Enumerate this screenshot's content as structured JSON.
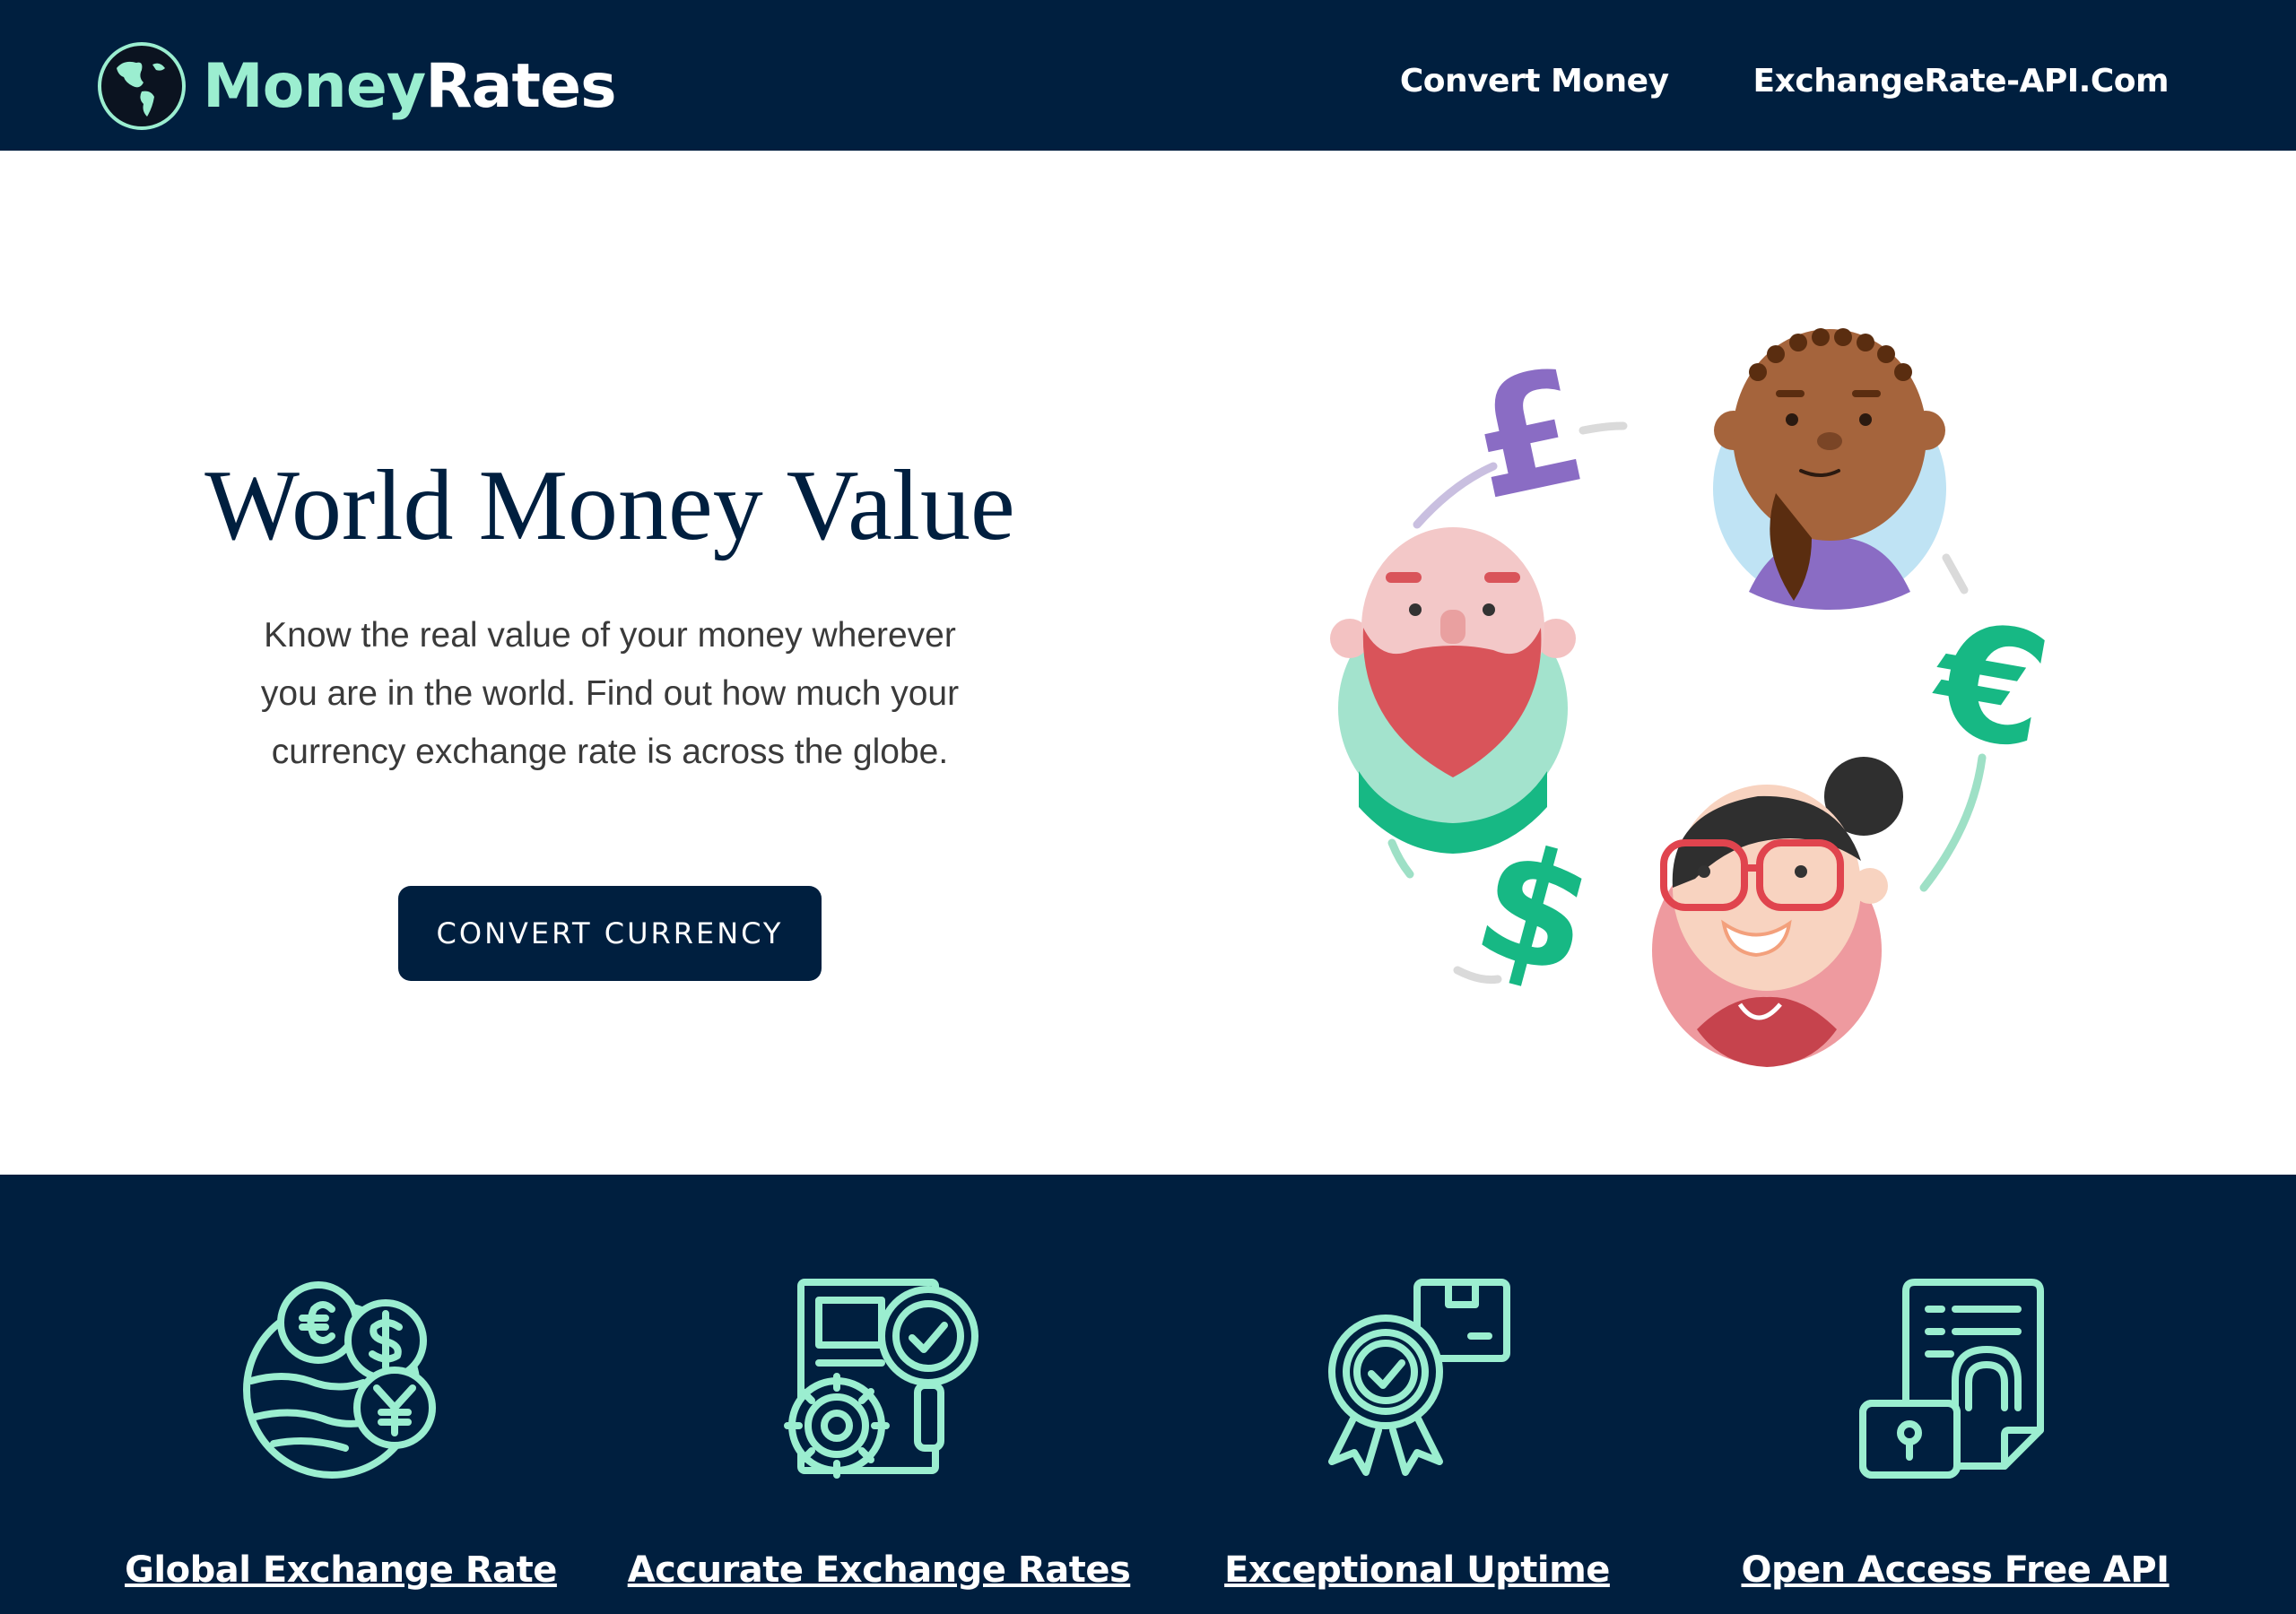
{
  "header": {
    "brand_part1": "Money",
    "brand_part2": "Rates",
    "nav": [
      {
        "label": "Convert Money"
      },
      {
        "label": "ExchangeRate-API.Com"
      }
    ]
  },
  "hero": {
    "title": "World Money Value",
    "description": "Know the real value of your money wherever you are in the world. Find out how much your currency exchange rate is across the globe.",
    "cta_label": "CONVERT CURRENCY",
    "currency_symbols": [
      "£",
      "€",
      "$"
    ]
  },
  "features": [
    {
      "label": "Global Exchange Rate",
      "icon": "globe-currencies-icon"
    },
    {
      "label": "Accurate Exchange Rates",
      "icon": "document-magnifier-icon"
    },
    {
      "label": "Exceptional Uptime",
      "icon": "award-badge-icon"
    },
    {
      "label": "Open Access Free API",
      "icon": "document-lock-icon"
    }
  ],
  "colors": {
    "navy": "#001f3f",
    "mint": "#9beed0",
    "pound_purple": "#8a6cc4",
    "currency_green": "#17b884"
  }
}
